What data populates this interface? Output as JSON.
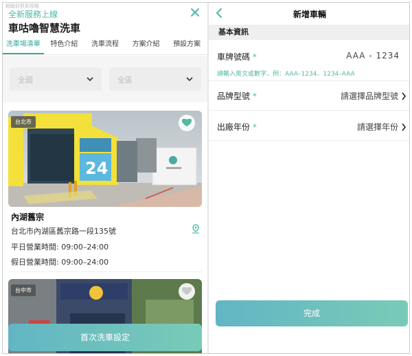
{
  "left": {
    "watermark": "超級好抓到攻略",
    "promo": "全新服務上線",
    "title": "車咕嚕智慧洗車",
    "tabs": [
      "洗車場清單",
      "特色介紹",
      "洗車流程",
      "方案介紹",
      "預設方案"
    ],
    "active_tab": 0,
    "filters": {
      "city": "全國",
      "district": "全區"
    },
    "stores": [
      {
        "city": "台北市",
        "name": "內湖舊宗",
        "address": "台北市內湖區舊宗路一段135號",
        "weekday": "平日營業時間: 09:00–24:00",
        "holiday": "假日營業時間: 09:00–24:00",
        "favorited": true
      },
      {
        "city": "台中市",
        "favorited": false
      }
    ],
    "cta": "首次洗車設定"
  },
  "right": {
    "title": "新增車輛",
    "section": "基本資訊",
    "fields": {
      "plate": {
        "label": "車牌號碼",
        "required": "*",
        "value": "AAA - 1234",
        "hint": "請輸入英文或數字，例：AAA–1234、1234–AAA"
      },
      "brand": {
        "label": "品牌型號",
        "required": "*",
        "value": "請選擇品牌型號"
      },
      "year": {
        "label": "出廠年份",
        "required": "*",
        "value": "請選擇年份"
      }
    },
    "cta": "完成"
  },
  "colors": {
    "accent": "#4fb9a5",
    "gradient_start": "#62b5c4",
    "gradient_end": "#79cbb7"
  }
}
